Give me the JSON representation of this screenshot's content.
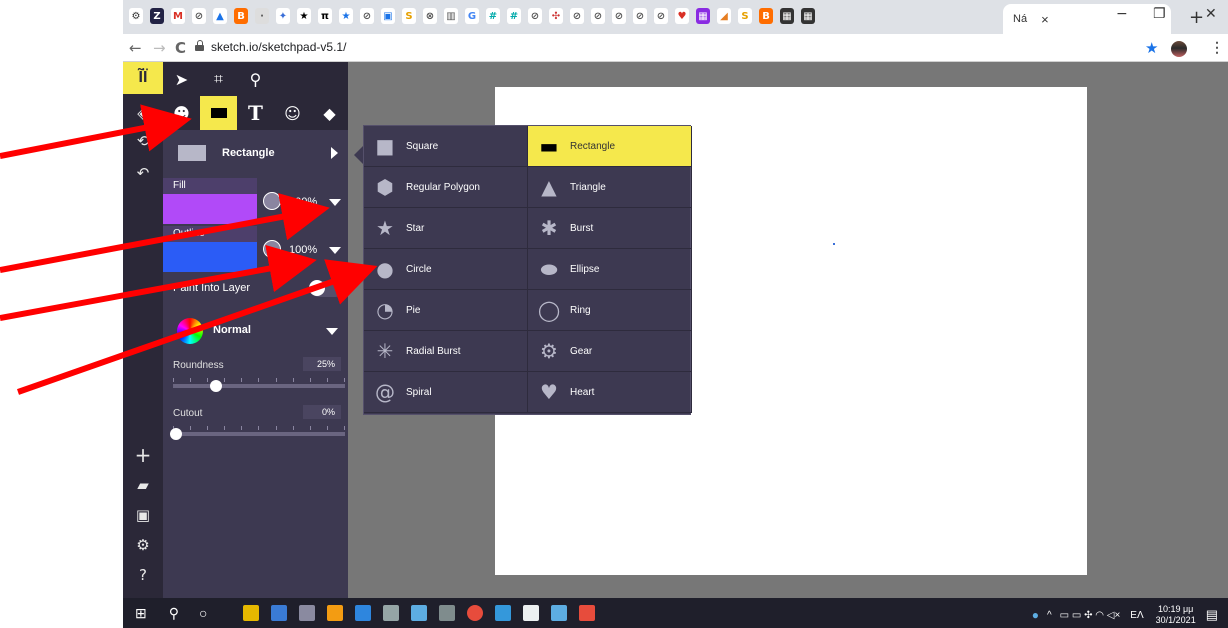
{
  "browser": {
    "tab_title": "Ná",
    "tab_close": "×",
    "new_tab": "+",
    "url": "sketch.io/sketchpad-v5.1/",
    "controls": {
      "back": "←",
      "forward": "→",
      "reload": "C",
      "minimize": "−",
      "restore": "❐",
      "close": "✕",
      "menu": "⋮",
      "bookmark": "★"
    }
  },
  "toolbar": {
    "logo": "ĨÏ",
    "top_tools": [
      "pointer",
      "crop",
      "zoom"
    ],
    "second_tools": [
      "ghost",
      "rectangle",
      "text",
      "sticker",
      "bucket"
    ],
    "text_glyph": "T"
  },
  "shape_selector": {
    "label": "Rectangle"
  },
  "fill": {
    "label": "Fill",
    "color": "#b14af8",
    "opacity": "100%"
  },
  "outline": {
    "label": "Outline",
    "color": "#2b5cf6",
    "opacity": "100%"
  },
  "paint_into_layer": {
    "label": "Paint Into Layer"
  },
  "blend": {
    "label": "Normal"
  },
  "roundness": {
    "label": "Roundness",
    "value": "25%"
  },
  "cutout": {
    "label": "Cutout",
    "value": "0%"
  },
  "shapes": [
    {
      "name": "Square",
      "icon": "■"
    },
    {
      "name": "Rectangle",
      "icon": "▬"
    },
    {
      "name": "Regular Polygon",
      "icon": "⬢"
    },
    {
      "name": "Triangle",
      "icon": "▲"
    },
    {
      "name": "Star",
      "icon": "★"
    },
    {
      "name": "Burst",
      "icon": "✱"
    },
    {
      "name": "Circle",
      "icon": "●"
    },
    {
      "name": "Ellipse",
      "icon": "⬬"
    },
    {
      "name": "Pie",
      "icon": "◔"
    },
    {
      "name": "Ring",
      "icon": "◯"
    },
    {
      "name": "Radial Burst",
      "icon": "✳"
    },
    {
      "name": "Gear",
      "icon": "⚙"
    },
    {
      "name": "Spiral",
      "icon": "@"
    },
    {
      "name": "Heart",
      "icon": "♥"
    }
  ],
  "selected_shape": "Rectangle",
  "taskbar": {
    "time": "10:19 μμ",
    "date": "30/1/2021",
    "lang": "ΕΛ"
  },
  "colors": {
    "accent": "#f5e84c",
    "panel": "#3d3951",
    "arrow": "#ff0000"
  }
}
